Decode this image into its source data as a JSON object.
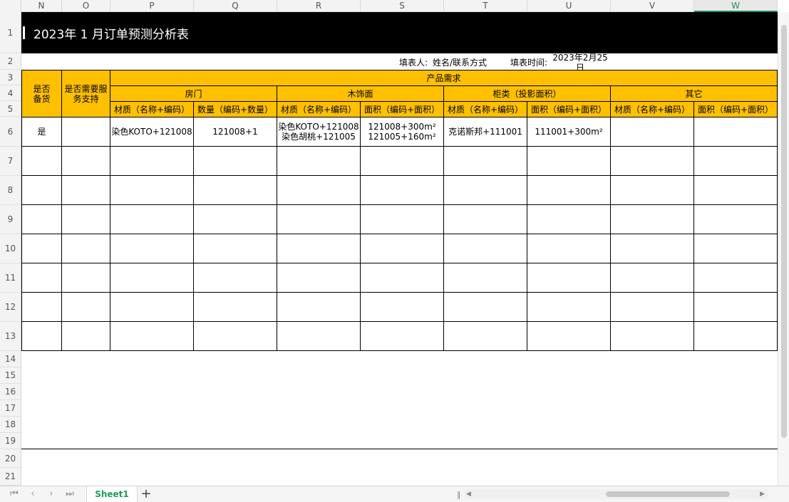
{
  "columns": [
    "N",
    "O",
    "P",
    "Q",
    "R",
    "S",
    "T",
    "U",
    "V",
    "W"
  ],
  "rows": [
    "1",
    "2",
    "3",
    "4",
    "5",
    "6",
    "7",
    "8",
    "9",
    "10",
    "11",
    "12",
    "13",
    "14",
    "15",
    "16",
    "17",
    "18",
    "19",
    "20",
    "21"
  ],
  "title": "2023年 1  月订单预测分析表",
  "info": {
    "filler_label": "填表人:",
    "filler_value": "姓名/联系方式",
    "time_label": "填表时间:",
    "time_value": "2023年2月25日"
  },
  "headers": {
    "stock": "是否\n备货",
    "service": "是否需要服\n务支持",
    "product_demand": "产品需求",
    "door": "房门",
    "wood": "木饰面",
    "cabinet": "柜类（投影面积）",
    "other": "其它",
    "sub": [
      "材质（名称+编码）",
      "数量（编码+数量）",
      "材质（名称+编码）",
      "面积（编码+面积）",
      "材质（名称+编码）",
      "面积（编码+面积）",
      "材质（名称+编码）",
      "面积（编码+面积）"
    ]
  },
  "data_row": {
    "stock": "是",
    "service": "",
    "door_material": "染色KOTO+121008",
    "door_qty": "121008+1",
    "wood_material": "染色KOTO+121008\n染色胡桃+121005",
    "wood_area": "121008+300m²\n121005+160m²",
    "cabinet_material": "克诺斯邦+111001",
    "cabinet_area": "111001+300m²",
    "other_material": "",
    "other_area": ""
  },
  "bottom": {
    "sheet_tab": "Sheet1",
    "add": "+",
    "nav_first": "⏮",
    "nav_prev": "‹",
    "nav_next": "›",
    "nav_last": "⏭"
  }
}
